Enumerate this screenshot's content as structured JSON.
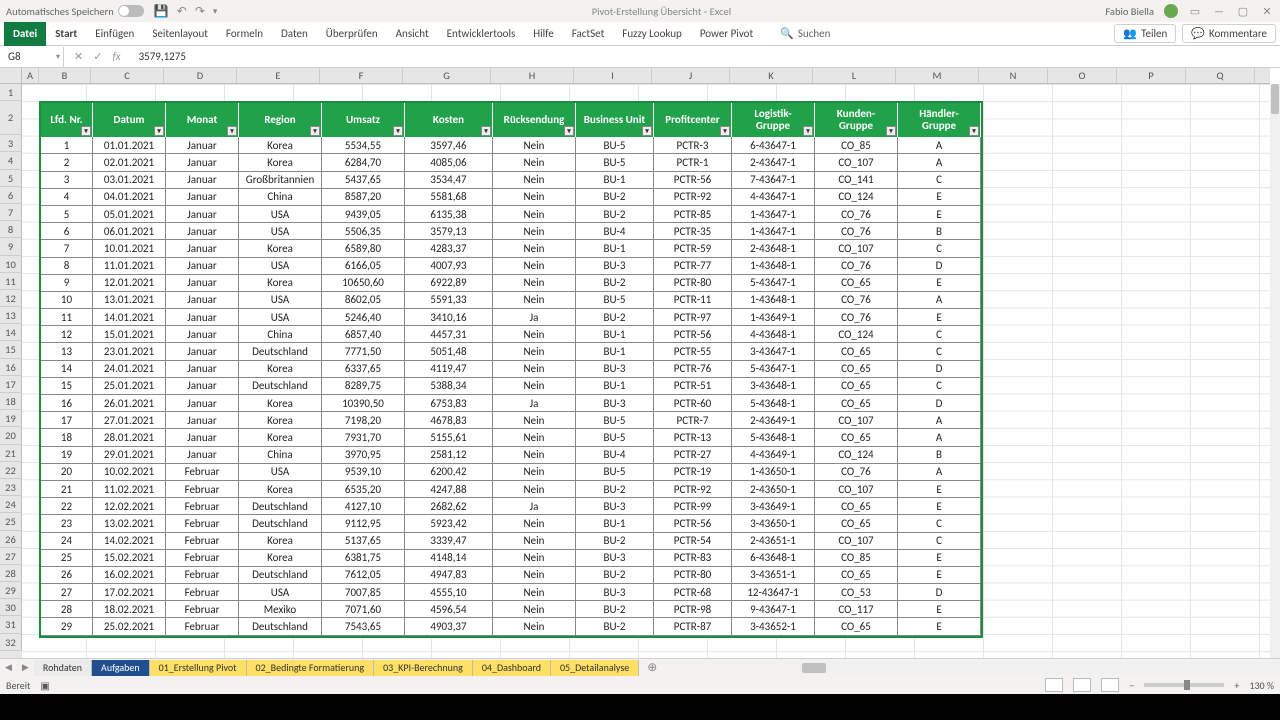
{
  "title_bar": {
    "auto_save_label": "Automatisches Speichern",
    "doc_title": "Pivot-Erstellung Übersicht ‑ Excel",
    "user_name": "Fabio Biella"
  },
  "ribbon": {
    "tabs": [
      "Datei",
      "Start",
      "Einfügen",
      "Seitenlayout",
      "Formeln",
      "Daten",
      "Überprüfen",
      "Ansicht",
      "Entwicklertools",
      "Hilfe",
      "FactSet",
      "Fuzzy Lookup",
      "Power Pivot"
    ],
    "search_label": "Suchen",
    "share_label": "Teilen",
    "comments_label": "Kommentare"
  },
  "formula_bar": {
    "name_box": "G8",
    "formula": "3579,1275"
  },
  "columns": [
    "A",
    "B",
    "C",
    "D",
    "E",
    "F",
    "G",
    "H",
    "I",
    "J",
    "K",
    "L",
    "M",
    "N",
    "O",
    "P",
    "Q"
  ],
  "table": {
    "headers": [
      "Lfd. Nr.",
      "Datum",
      "Monat",
      "Region",
      "Umsatz",
      "Kosten",
      "Rücksendung",
      "Business Unit",
      "Profitcenter",
      "Logistik-Gruppe",
      "Kunden-Gruppe",
      "Händler-Gruppe"
    ],
    "rows": [
      [
        "1",
        "01.01.2021",
        "Januar",
        "Korea",
        "5534,55",
        "3597,46",
        "Nein",
        "BU-5",
        "PCTR-3",
        "6-43647-1",
        "CO_85",
        "A"
      ],
      [
        "2",
        "02.01.2021",
        "Januar",
        "Korea",
        "6284,70",
        "4085,06",
        "Nein",
        "BU-5",
        "PCTR-1",
        "2-43647-1",
        "CO_107",
        "A"
      ],
      [
        "3",
        "03.01.2021",
        "Januar",
        "Großbritannien",
        "5437,65",
        "3534,47",
        "Nein",
        "BU-1",
        "PCTR-56",
        "7-43647-1",
        "CO_141",
        "C"
      ],
      [
        "4",
        "04.01.2021",
        "Januar",
        "China",
        "8587,20",
        "5581,68",
        "Nein",
        "BU-2",
        "PCTR-92",
        "4-43647-1",
        "CO_124",
        "E"
      ],
      [
        "5",
        "05.01.2021",
        "Januar",
        "USA",
        "9439,05",
        "6135,38",
        "Nein",
        "BU-2",
        "PCTR-85",
        "1-43647-1",
        "CO_76",
        "E"
      ],
      [
        "6",
        "06.01.2021",
        "Januar",
        "USA",
        "5506,35",
        "3579,13",
        "Nein",
        "BU-4",
        "PCTR-35",
        "1-43647-1",
        "CO_76",
        "B"
      ],
      [
        "7",
        "10.01.2021",
        "Januar",
        "Korea",
        "6589,80",
        "4283,37",
        "Nein",
        "BU-1",
        "PCTR-59",
        "2-43648-1",
        "CO_107",
        "C"
      ],
      [
        "8",
        "11.01.2021",
        "Januar",
        "USA",
        "6166,05",
        "4007,93",
        "Nein",
        "BU-3",
        "PCTR-77",
        "1-43648-1",
        "CO_76",
        "D"
      ],
      [
        "9",
        "12.01.2021",
        "Januar",
        "Korea",
        "10650,60",
        "6922,89",
        "Nein",
        "BU-2",
        "PCTR-80",
        "5-43647-1",
        "CO_65",
        "E"
      ],
      [
        "10",
        "13.01.2021",
        "Januar",
        "USA",
        "8602,05",
        "5591,33",
        "Nein",
        "BU-5",
        "PCTR-11",
        "1-43648-1",
        "CO_76",
        "A"
      ],
      [
        "11",
        "14.01.2021",
        "Januar",
        "USA",
        "5246,40",
        "3410,16",
        "Ja",
        "BU-2",
        "PCTR-97",
        "1-43649-1",
        "CO_76",
        "E"
      ],
      [
        "12",
        "15.01.2021",
        "Januar",
        "China",
        "6857,40",
        "4457,31",
        "Nein",
        "BU-1",
        "PCTR-56",
        "4-43648-1",
        "CO_124",
        "C"
      ],
      [
        "13",
        "23.01.2021",
        "Januar",
        "Deutschland",
        "7771,50",
        "5051,48",
        "Nein",
        "BU-1",
        "PCTR-55",
        "3-43647-1",
        "CO_65",
        "C"
      ],
      [
        "14",
        "24.01.2021",
        "Januar",
        "Korea",
        "6337,65",
        "4119,47",
        "Nein",
        "BU-3",
        "PCTR-76",
        "5-43647-1",
        "CO_65",
        "D"
      ],
      [
        "15",
        "25.01.2021",
        "Januar",
        "Deutschland",
        "8289,75",
        "5388,34",
        "Nein",
        "BU-1",
        "PCTR-51",
        "3-43648-1",
        "CO_65",
        "C"
      ],
      [
        "16",
        "26.01.2021",
        "Januar",
        "Korea",
        "10390,50",
        "6753,83",
        "Ja",
        "BU-3",
        "PCTR-60",
        "5-43648-1",
        "CO_65",
        "D"
      ],
      [
        "17",
        "27.01.2021",
        "Januar",
        "Korea",
        "7198,20",
        "4678,83",
        "Nein",
        "BU-5",
        "PCTR-7",
        "2-43649-1",
        "CO_107",
        "A"
      ],
      [
        "18",
        "28.01.2021",
        "Januar",
        "Korea",
        "7931,70",
        "5155,61",
        "Nein",
        "BU-5",
        "PCTR-13",
        "5-43648-1",
        "CO_65",
        "A"
      ],
      [
        "19",
        "29.01.2021",
        "Januar",
        "China",
        "3970,95",
        "2581,12",
        "Nein",
        "BU-4",
        "PCTR-27",
        "4-43649-1",
        "CO_124",
        "B"
      ],
      [
        "20",
        "10.02.2021",
        "Februar",
        "USA",
        "9539,10",
        "6200,42",
        "Nein",
        "BU-5",
        "PCTR-19",
        "1-43650-1",
        "CO_76",
        "A"
      ],
      [
        "21",
        "11.02.2021",
        "Februar",
        "Korea",
        "6535,20",
        "4247,88",
        "Nein",
        "BU-2",
        "PCTR-92",
        "2-43650-1",
        "CO_107",
        "E"
      ],
      [
        "22",
        "12.02.2021",
        "Februar",
        "Deutschland",
        "4127,10",
        "2682,62",
        "Ja",
        "BU-3",
        "PCTR-99",
        "3-43649-1",
        "CO_65",
        "E"
      ],
      [
        "23",
        "13.02.2021",
        "Februar",
        "Deutschland",
        "9112,95",
        "5923,42",
        "Nein",
        "BU-1",
        "PCTR-56",
        "3-43650-1",
        "CO_65",
        "C"
      ],
      [
        "24",
        "14.02.2021",
        "Februar",
        "Korea",
        "5137,65",
        "3339,47",
        "Nein",
        "BU-2",
        "PCTR-54",
        "2-43651-1",
        "CO_107",
        "C"
      ],
      [
        "25",
        "15.02.2021",
        "Februar",
        "Korea",
        "6381,75",
        "4148,14",
        "Nein",
        "BU-3",
        "PCTR-83",
        "6-43648-1",
        "CO_85",
        "E"
      ],
      [
        "26",
        "16.02.2021",
        "Februar",
        "Deutschland",
        "7612,05",
        "4947,83",
        "Nein",
        "BU-2",
        "PCTR-80",
        "3-43651-1",
        "CO_65",
        "E"
      ],
      [
        "27",
        "17.02.2021",
        "Februar",
        "USA",
        "7007,85",
        "4555,10",
        "Nein",
        "BU-3",
        "PCTR-68",
        "12-43647-1",
        "CO_53",
        "D"
      ],
      [
        "28",
        "18.02.2021",
        "Februar",
        "Mexiko",
        "7071,60",
        "4596,54",
        "Nein",
        "BU-2",
        "PCTR-98",
        "9-43647-1",
        "CO_117",
        "E"
      ],
      [
        "29",
        "25.02.2021",
        "Februar",
        "Deutschland",
        "7543,65",
        "4903,37",
        "Nein",
        "BU-2",
        "PCTR-87",
        "3-43652-1",
        "CO_65",
        "E"
      ]
    ]
  },
  "sheet_tabs": [
    {
      "label": "Rohdaten",
      "cls": "gray"
    },
    {
      "label": "Aufgaben",
      "cls": "blue"
    },
    {
      "label": "01_Erstellung Pivot",
      "cls": "yellow"
    },
    {
      "label": "02_Bedingte Formatierung",
      "cls": "yellow"
    },
    {
      "label": "03_KPI-Berechnung",
      "cls": "yellow"
    },
    {
      "label": "04_Dashboard",
      "cls": "yellow"
    },
    {
      "label": "05_Detailanalyse",
      "cls": "yellow"
    }
  ],
  "status_bar": {
    "ready": "Bereit",
    "zoom": "130 %"
  }
}
